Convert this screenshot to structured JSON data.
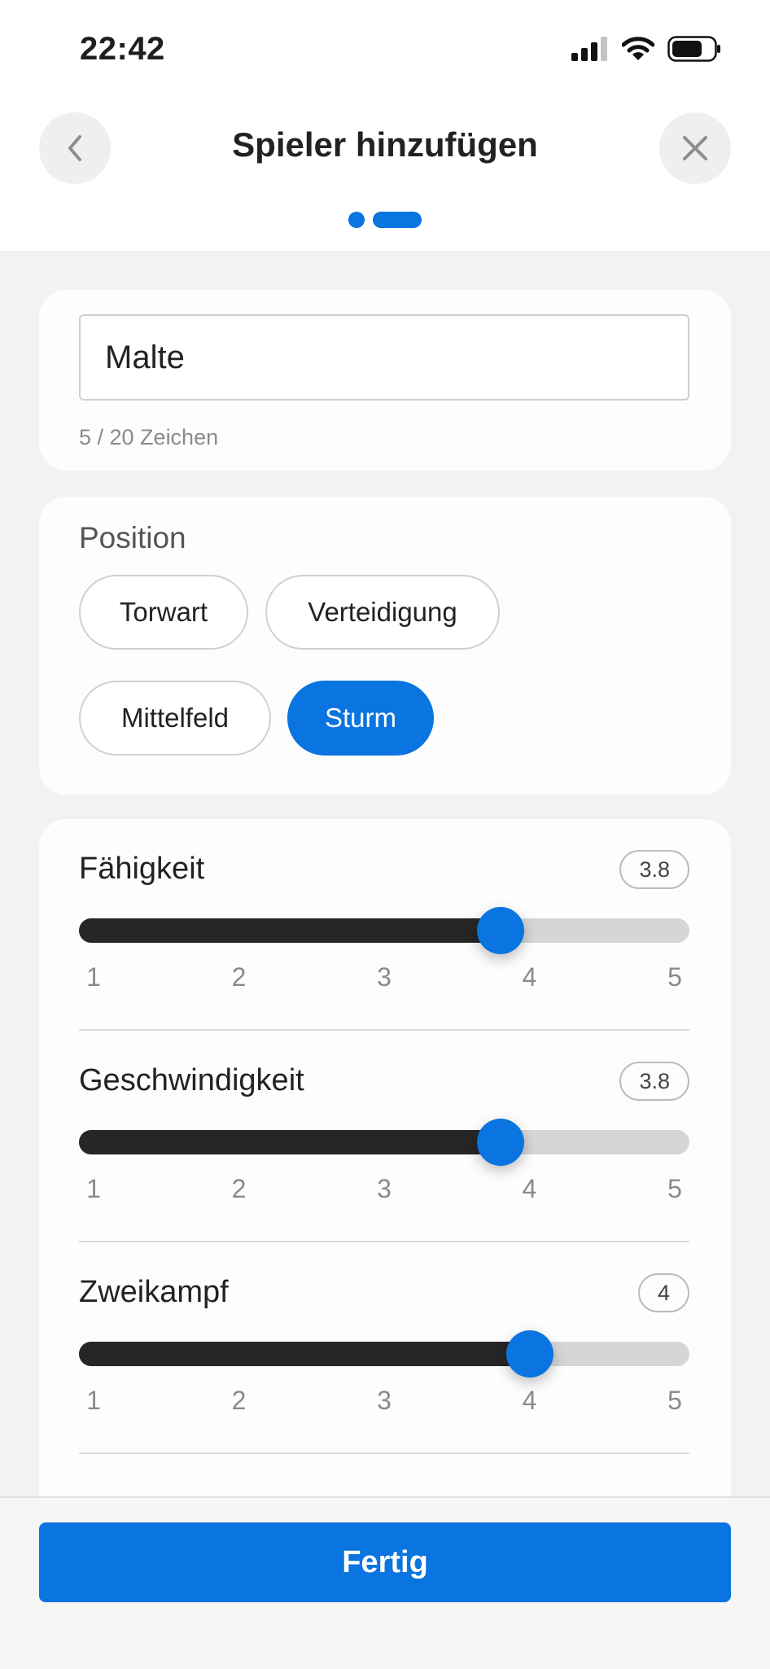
{
  "status_bar": {
    "time": "22:42"
  },
  "header": {
    "title": "Spieler hinzufügen",
    "step_current": 2,
    "step_total": 2
  },
  "name_card": {
    "value": "Malte",
    "counter": "5 / 20 Zeichen"
  },
  "position_card": {
    "label": "Position",
    "options": [
      "Torwart",
      "Verteidigung",
      "Mittelfeld",
      "Sturm"
    ],
    "selected": "Sturm"
  },
  "skills": {
    "scale_min": 1,
    "scale_max": 5,
    "ticks": [
      "1",
      "2",
      "3",
      "4",
      "5"
    ],
    "items": [
      {
        "name": "Fähigkeit",
        "badge": "3.8",
        "value": 3.8
      },
      {
        "name": "Geschwindigkeit",
        "badge": "3.8",
        "value": 3.8
      },
      {
        "name": "Zweikampf",
        "badge": "4",
        "value": 4
      }
    ]
  },
  "footer": {
    "done_label": "Fertig"
  },
  "colors": {
    "accent": "#0a74e0",
    "track_fill": "#262626",
    "track_empty": "#d6d6d6"
  }
}
